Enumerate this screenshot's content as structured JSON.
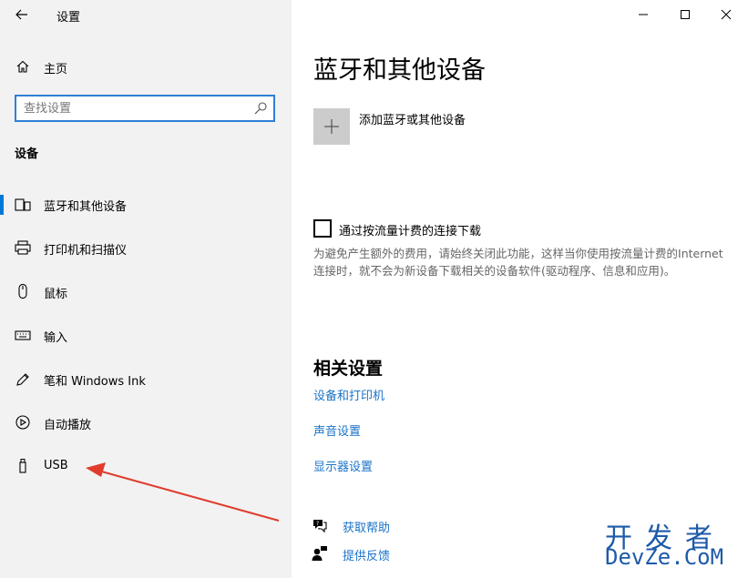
{
  "window": {
    "title": "设置"
  },
  "sidebar": {
    "home_label": "主页",
    "search_placeholder": "查找设置",
    "section_label": "设备",
    "items": [
      {
        "label": "蓝牙和其他设备",
        "icon": "bluetooth-icon",
        "active": true
      },
      {
        "label": "打印机和扫描仪",
        "icon": "printer-icon",
        "active": false
      },
      {
        "label": "鼠标",
        "icon": "mouse-icon",
        "active": false
      },
      {
        "label": "输入",
        "icon": "keyboard-icon",
        "active": false
      },
      {
        "label": "笔和 Windows Ink",
        "icon": "pen-icon",
        "active": false
      },
      {
        "label": "自动播放",
        "icon": "autoplay-icon",
        "active": false
      },
      {
        "label": "USB",
        "icon": "usb-icon",
        "active": false
      }
    ]
  },
  "main": {
    "title": "蓝牙和其他设备",
    "add_device_label": "添加蓝牙或其他设备",
    "metered_label": "通过按流量计费的连接下载",
    "metered_checked": false,
    "metered_description": "为避免产生额外的费用，请始终关闭此功能，这样当你使用按流量计费的Internet 连接时，就不会为新设备下载相关的设备软件(驱动程序、信息和应用)。",
    "related_title": "相关设置",
    "related_links": [
      "设备和打印机",
      "声音设置",
      "显示器设置"
    ],
    "help": {
      "get_help": "获取帮助",
      "feedback": "提供反馈"
    }
  },
  "watermark": {
    "cn": "开发者",
    "en": "DevZe.CoM"
  },
  "colors": {
    "accent": "#0078d7",
    "link": "#1a73c8",
    "sidebar_bg": "#f2f2f2",
    "annotation_arrow": "#e03c2e"
  }
}
